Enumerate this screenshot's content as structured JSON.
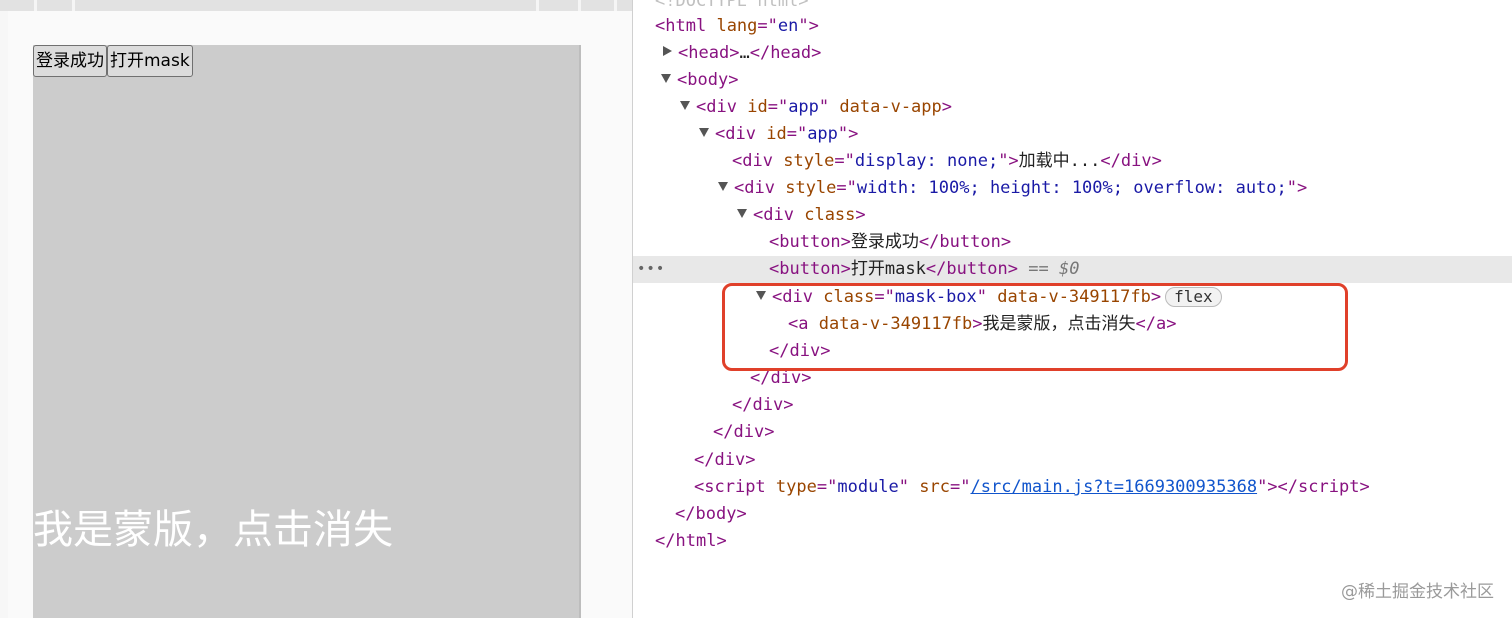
{
  "preview": {
    "buttons": [
      "登录成功",
      "打开mask"
    ],
    "mask_text": "我是蒙版，点击消失"
  },
  "devtools": {
    "doctype": "<!DOCTYPE html>",
    "lines": {
      "html_open": {
        "tag": "html",
        "attr": "lang",
        "val": "en"
      },
      "head": "head",
      "head_ellipsis": "…",
      "body_open": "body",
      "app_outer": {
        "tag": "div",
        "attr1": "id",
        "val1": "app",
        "attr2": "data-v-app"
      },
      "app_inner": {
        "tag": "div",
        "attr": "id",
        "val": "app"
      },
      "loading": {
        "tag": "div",
        "attr": "style",
        "val": "display: none;",
        "text": "加载中..."
      },
      "scroll_div": {
        "tag": "div",
        "attr": "style",
        "val": "width: 100%; height: 100%; overflow: auto;"
      },
      "class_div": {
        "tag": "div",
        "attr": "class"
      },
      "btn1": {
        "tag": "button",
        "text": "登录成功"
      },
      "btn2": {
        "tag": "button",
        "text": "打开mask",
        "selector": "== $0"
      },
      "mask_div": {
        "tag": "div",
        "attr1": "class",
        "val1": "mask-box",
        "attr2": "data-v-349117fb",
        "badge": "flex"
      },
      "mask_a": {
        "tag": "a",
        "attr": "data-v-349117fb",
        "text": "我是蒙版，点击消失"
      },
      "script": {
        "tag": "script",
        "attr1": "type",
        "val1": "module",
        "attr2": "src",
        "val2": "/src/main.js?t=1669300935368"
      }
    },
    "close_tags": {
      "div": "div",
      "body": "body",
      "html": "html"
    }
  },
  "watermark": "@稀土掘金技术社区"
}
